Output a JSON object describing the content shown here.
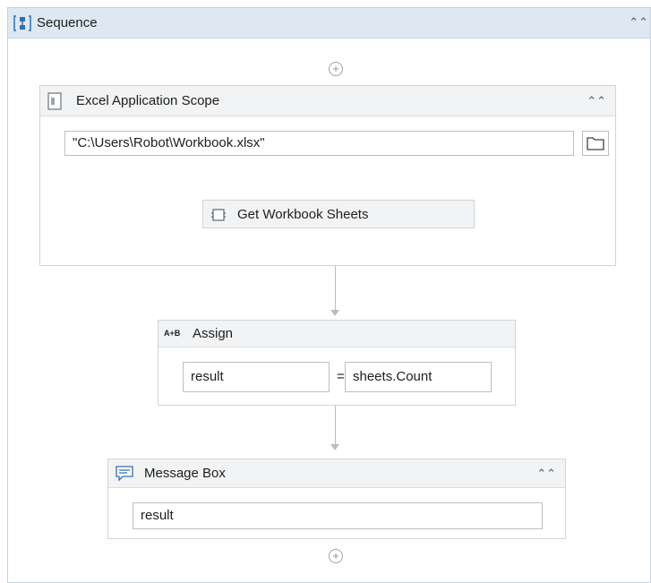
{
  "sequence": {
    "title": "Sequence",
    "collapse_icon": "double-chevron-up-icon"
  },
  "excel_scope": {
    "title": "Excel Application Scope",
    "workbook_path": "\"C:\\Users\\Robot\\Workbook.xlsx\"",
    "browse_icon": "folder-icon",
    "inner_activity": {
      "title": "Get Workbook Sheets",
      "icon": "sheets-icon"
    }
  },
  "assign": {
    "badge": "A+B",
    "title": "Assign",
    "to_value": "result",
    "equals": "=",
    "value": "sheets.Count"
  },
  "message_box": {
    "title": "Message Box",
    "text_value": "result",
    "icon": "message-icon"
  }
}
